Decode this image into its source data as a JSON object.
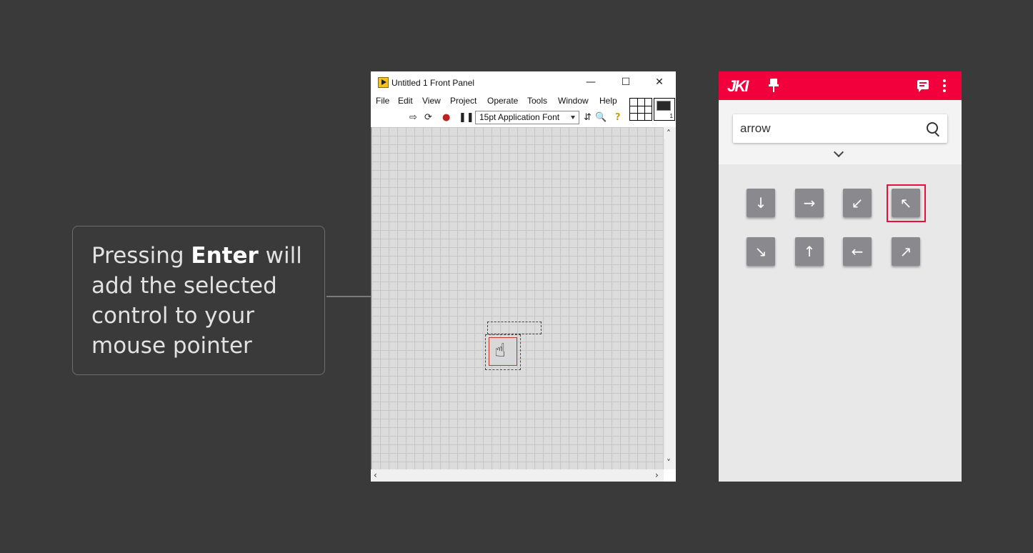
{
  "callout": {
    "text_before": "Pressing ",
    "text_bold": "Enter",
    "text_after": " will add the selected control to your mouse pointer"
  },
  "labview": {
    "title": "Untitled 1 Front Panel",
    "menu": [
      "File",
      "Edit",
      "View",
      "Project",
      "Operate",
      "Tools",
      "Window",
      "Help"
    ],
    "font_select": "15pt Application Font",
    "vi_icon_number": "1"
  },
  "jki": {
    "logo": "JKI",
    "search": {
      "value": "arrow"
    },
    "results": [
      {
        "glyph": "↓",
        "name": "arrow-down"
      },
      {
        "glyph": "→",
        "name": "arrow-right"
      },
      {
        "glyph": "↙",
        "name": "arrow-down-left"
      },
      {
        "glyph": "↖",
        "name": "arrow-up-left",
        "selected": true
      },
      {
        "glyph": "↘",
        "name": "arrow-down-right"
      },
      {
        "glyph": "↑",
        "name": "arrow-up"
      },
      {
        "glyph": "←",
        "name": "arrow-left"
      },
      {
        "glyph": "↗",
        "name": "arrow-up-right"
      }
    ],
    "colors": {
      "accent": "#f2003c",
      "selection": "#e8103a",
      "tile": "#8a8a8e"
    }
  }
}
